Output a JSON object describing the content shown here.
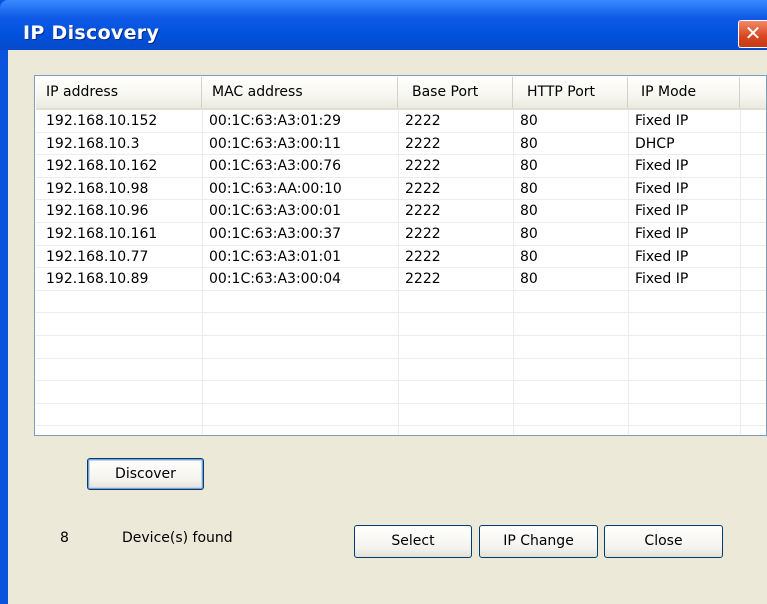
{
  "window": {
    "title": "IP Discovery",
    "close_glyph": "✕"
  },
  "table": {
    "columns": [
      "IP address",
      "MAC address",
      "Base Port",
      "HTTP Port",
      "IP Mode"
    ],
    "rows": [
      [
        "192.168.10.152",
        "00:1C:63:A3:01:29",
        "2222",
        "80",
        "Fixed IP"
      ],
      [
        "192.168.10.3",
        "00:1C:63:A3:00:11",
        "2222",
        "80",
        "DHCP"
      ],
      [
        "192.168.10.162",
        "00:1C:63:A3:00:76",
        "2222",
        "80",
        "Fixed IP"
      ],
      [
        "192.168.10.98",
        "00:1C:63:AA:00:10",
        "2222",
        "80",
        "Fixed IP"
      ],
      [
        "192.168.10.96",
        "00:1C:63:A3:00:01",
        "2222",
        "80",
        "Fixed IP"
      ],
      [
        "192.168.10.161",
        "00:1C:63:A3:00:37",
        "2222",
        "80",
        "Fixed IP"
      ],
      [
        "192.168.10.77",
        "00:1C:63:A3:01:01",
        "2222",
        "80",
        "Fixed IP"
      ],
      [
        "192.168.10.89",
        "00:1C:63:A3:00:04",
        "2222",
        "80",
        "Fixed IP"
      ]
    ]
  },
  "buttons": {
    "discover": "Discover",
    "select": "Select",
    "ip_change": "IP Change",
    "close": "Close"
  },
  "status": {
    "count": "8",
    "text": "Device(s) found"
  },
  "colors": {
    "titlebar": "#0a53dc",
    "client": "#ece9d8",
    "close_button": "#d9461f"
  }
}
